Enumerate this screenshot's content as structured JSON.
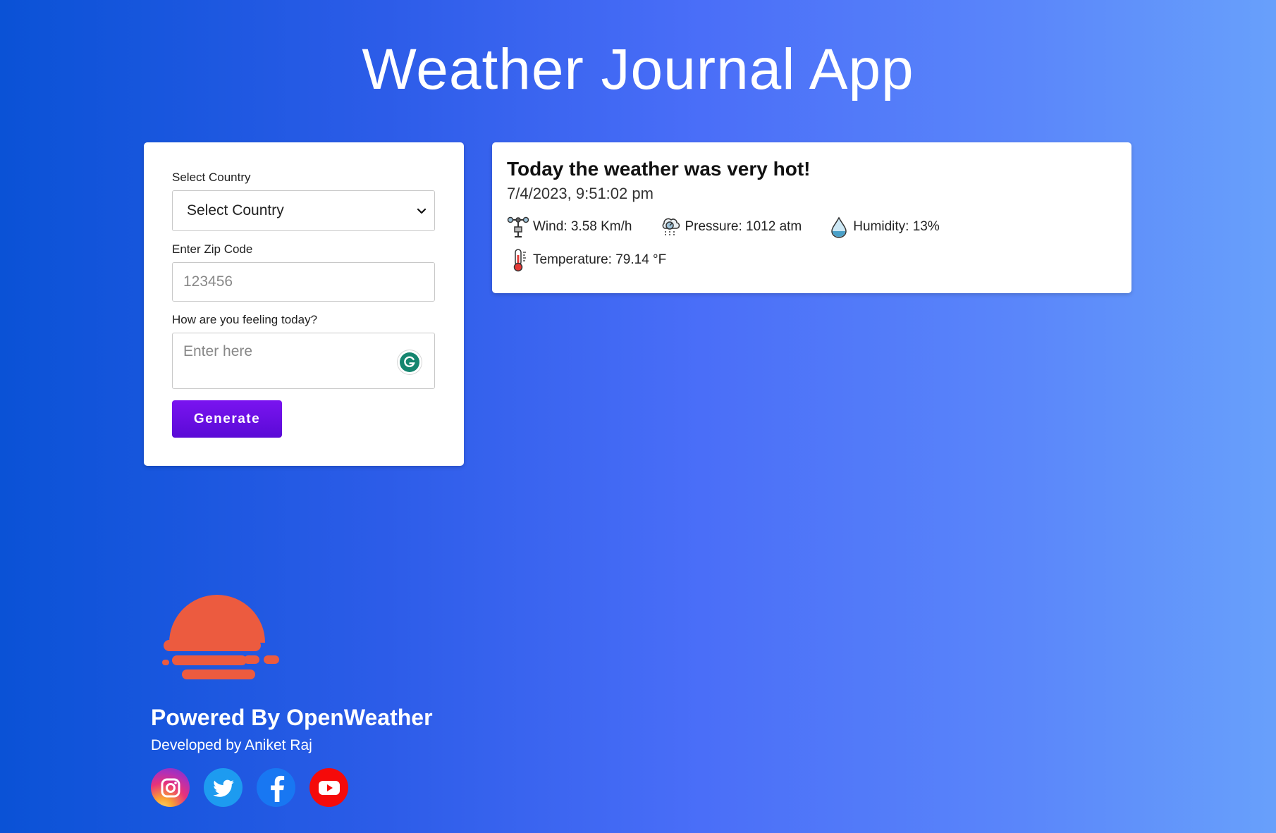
{
  "header": {
    "title": "Weather Journal App"
  },
  "form": {
    "country_label": "Select Country",
    "country_selected": "Select Country",
    "zip_label": "Enter Zip Code",
    "zip_placeholder": "123456",
    "feeling_label": "How are you feeling today?",
    "feeling_placeholder": "Enter here",
    "generate_label": "Generate"
  },
  "entry": {
    "heading": "Today the weather was very hot!",
    "date": "7/4/2023, 9:51:02 pm",
    "wind": "Wind: 3.58 Km/h",
    "pressure": "Pressure: 1012 atm",
    "humidity": "Humidity: 13%",
    "temperature": "Temperature: 79.14 °F"
  },
  "footer": {
    "powered_by": "Powered By OpenWeather",
    "developer": "Developed by Aniket Raj",
    "social_icons": [
      "instagram-icon",
      "twitter-icon",
      "facebook-icon",
      "youtube-icon"
    ]
  },
  "colors": {
    "accent_button": "#6a0ee8",
    "logo": "#ec5b3f",
    "background_start": "#0a52d6",
    "background_end": "#68a0fb"
  }
}
